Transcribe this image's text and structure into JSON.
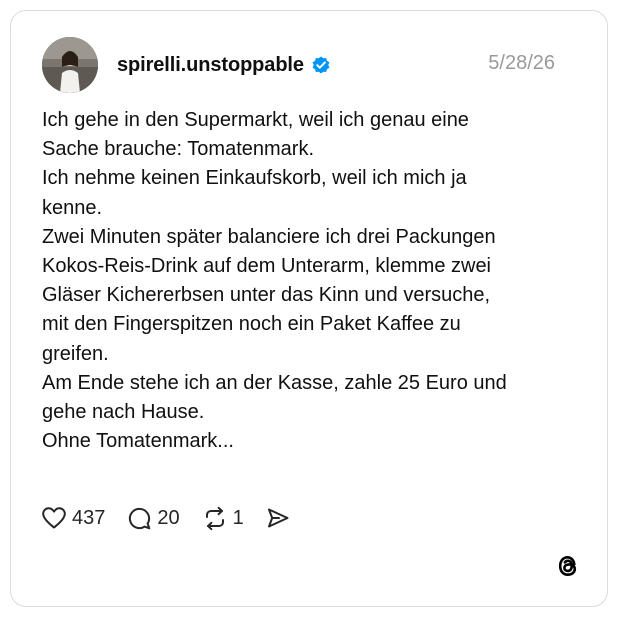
{
  "post": {
    "username": "spirelli.unstoppable",
    "verified": true,
    "date": "5/28/26",
    "lines": [
      "Ich gehe in den Supermarkt, weil ich genau eine",
      "Sache brauche: Tomatenmark.",
      "Ich nehme keinen Einkaufskorb, weil ich mich ja",
      "kenne.",
      "Zwei Minuten später balanciere ich drei Packungen",
      "Kokos-Reis-Drink auf dem Unterarm, klemme zwei",
      "Gläser Kichererbsen unter das Kinn und versuche,",
      "mit den Fingerspitzen noch ein Paket Kaffee zu",
      "greifen.",
      "Am Ende stehe ich an der Kasse, zahle 25 Euro und",
      "gehe nach Hause.",
      "Ohne Tomatenmark..."
    ]
  },
  "actions": {
    "likes": "437",
    "replies": "20",
    "reposts": "1"
  },
  "icons": {
    "like": "heart-icon",
    "reply": "comment-icon",
    "repost": "repost-icon",
    "share": "share-icon",
    "verified": "verified-badge-icon",
    "brand": "threads-logo-icon"
  },
  "colors": {
    "verified_blue": "#0095f6",
    "text": "#101010",
    "muted": "#9a9a9a"
  }
}
